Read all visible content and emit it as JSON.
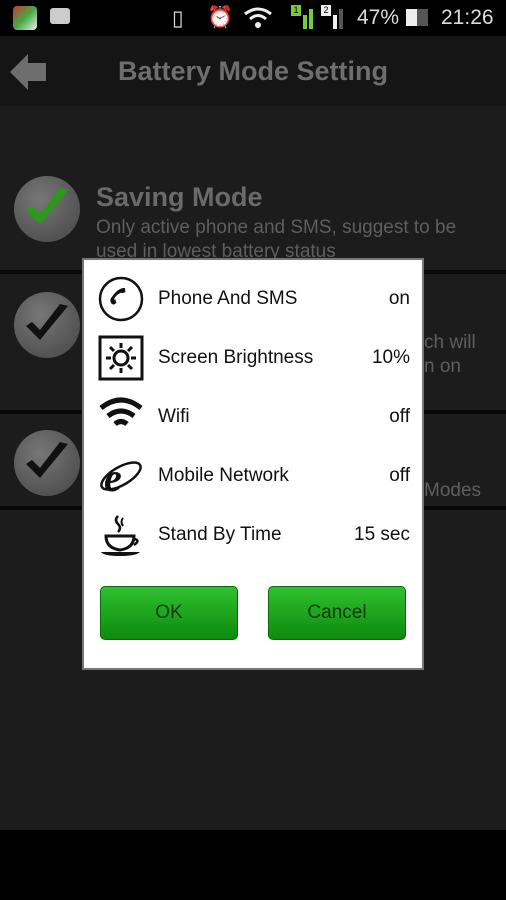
{
  "status_bar": {
    "battery": "47%",
    "time": "21:26",
    "sim1": "1",
    "sim2": "2"
  },
  "header": {
    "title": "Battery Mode Setting"
  },
  "modes": [
    {
      "title": "Saving Mode",
      "description": "Only active phone and SMS, suggest to be used in lowest battery status",
      "checked_color": "#2a9a1a"
    },
    {
      "fragments": [
        "ch will",
        "n on"
      ]
    },
    {
      "fragments": [
        "Modes"
      ]
    }
  ],
  "dialog": {
    "items": [
      {
        "icon": "phone-icon",
        "label": "Phone And SMS",
        "value": "on"
      },
      {
        "icon": "brightness-icon",
        "label": "Screen Brightness",
        "value": "10%"
      },
      {
        "icon": "wifi-icon",
        "label": "Wifi",
        "value": "off"
      },
      {
        "icon": "internet-explorer-icon",
        "label": "Mobile Network",
        "value": "off"
      },
      {
        "icon": "coffee-cup-icon",
        "label": "Stand By Time",
        "value": "15 sec"
      }
    ],
    "ok_label": "OK",
    "cancel_label": "Cancel",
    "button_color": "#1aa61a"
  }
}
